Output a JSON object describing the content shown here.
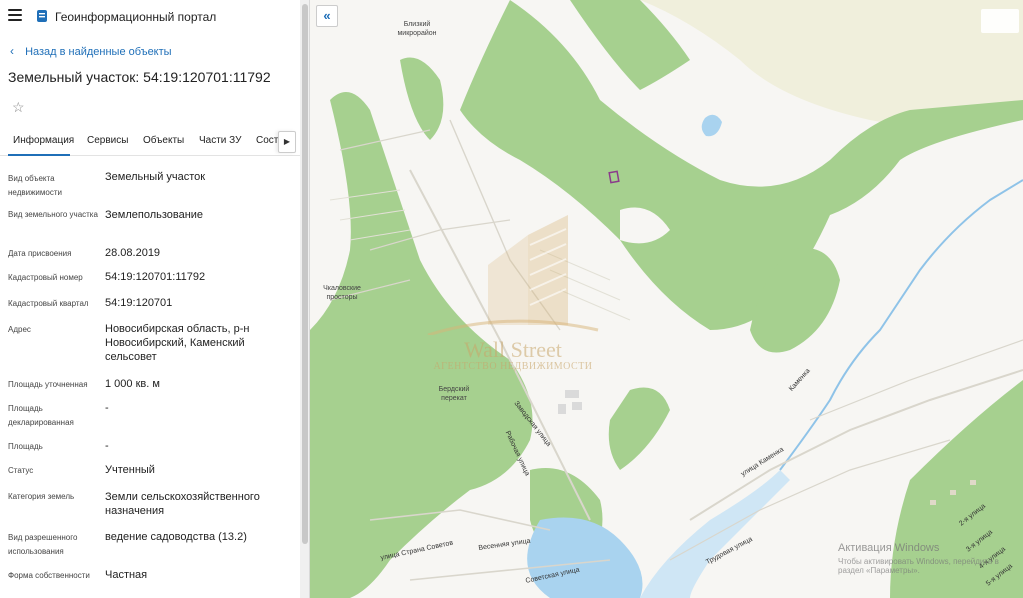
{
  "app": {
    "title": "Геоинформационный портал"
  },
  "back_link": "Назад в найденные объекты",
  "object_title": "Земельный участок: 54:19:120701:11792",
  "tabs": [
    {
      "label": "Информация",
      "active": true
    },
    {
      "label": "Сервисы"
    },
    {
      "label": "Объекты"
    },
    {
      "label": "Части ЗУ"
    },
    {
      "label": "Состав"
    }
  ],
  "properties": [
    {
      "label": "Вид объекта недвижимости",
      "value": "Земельный участок"
    },
    {
      "label": "Вид земельного участка",
      "value": "Землепользование"
    },
    {
      "label": "Дата присвоения",
      "value": "28.08.2019"
    },
    {
      "label": "Кадастровый номер",
      "value": "54:19:120701:11792"
    },
    {
      "label": "Кадастровый квартал",
      "value": "54:19:120701"
    },
    {
      "label": "Адрес",
      "value": "Новосибирская область, р-н Новосибирский, Каменский сельсовет"
    },
    {
      "label": "Площадь уточненная",
      "value": "1 000 кв. м"
    },
    {
      "label": "Площадь декларированная",
      "value": "-"
    },
    {
      "label": "Площадь",
      "value": "-"
    },
    {
      "label": "Статус",
      "value": "Учтенный"
    },
    {
      "label": "Категория земель",
      "value": "Земли сельскохозяйственного назначения"
    },
    {
      "label": "Вид разрешенного использования",
      "value": "ведение садоводства (13.2)"
    },
    {
      "label": "Форма собственности",
      "value": "Частная"
    }
  ],
  "map": {
    "places": [
      "Близкий микрорайон",
      "Чкаловские просторы",
      "Бердский перекат"
    ],
    "streets": [
      "Заводская улица",
      "Рабочая улица",
      "улица Страна Советов",
      "Весенняя улица",
      "Советская улица",
      "Трудовая улица",
      "улица Каменка",
      "Каменка",
      "2-я улица",
      "3-я улица",
      "4-я улица",
      "5-я улица"
    ],
    "watermark": {
      "title": "Wall Street",
      "subtitle": "АГЕНТСТВО НЕДВИЖИМОСТИ"
    }
  },
  "os_overlay": {
    "title": "Активация Windows",
    "subtitle": "Чтобы активировать Windows, перейдите в раздел «Параметры»."
  },
  "colors": {
    "forest": "#a6d08f",
    "water": "#a9d3ef",
    "river_line": "#8fc3e8",
    "field": "#f0f0de",
    "accent": "#1f6fb8",
    "parcel": "#8b3a8b"
  }
}
